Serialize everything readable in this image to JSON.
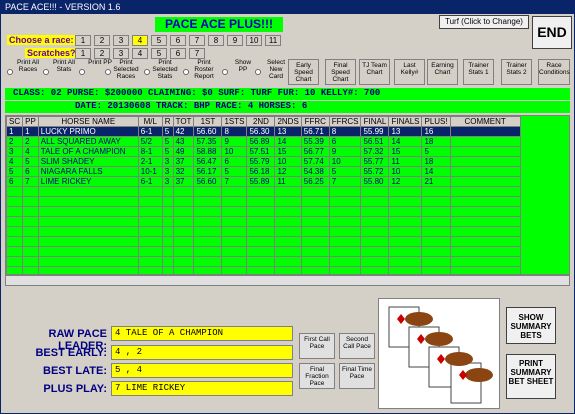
{
  "window": {
    "title": "PACE ACE!!! - VERSION 1.6"
  },
  "header": {
    "heading": "PACE ACE PLUS!!!",
    "choose_label": "Choose a race:",
    "scratches_label": "Scratches?",
    "race_buttons": [
      "1",
      "2",
      "3",
      "4",
      "5",
      "6",
      "7",
      "8",
      "9",
      "10",
      "11"
    ],
    "selected_race": "4",
    "scratch_buttons": [
      "1",
      "2",
      "3",
      "4",
      "5",
      "6",
      "7"
    ],
    "turf_button": "Turf (Click to Change)",
    "end_button": "END"
  },
  "options": [
    {
      "label": "Print All Races"
    },
    {
      "label": "Print All Stats"
    },
    {
      "label": "Print PP"
    },
    {
      "label": "Print Selected Races"
    },
    {
      "label": "Print Selected Stats"
    },
    {
      "label": "Print Roster Report"
    },
    {
      "label": "Show PP"
    },
    {
      "label": "Select New Card"
    }
  ],
  "chart_buttons": [
    {
      "label": "Early Speed Chart"
    },
    {
      "label": "Final Speed Chart"
    },
    {
      "label": "TJ Team Chart"
    },
    {
      "label": "Last Kelly#"
    },
    {
      "label": "Earning Chart"
    },
    {
      "label": "Trainer Stats 1"
    },
    {
      "label": "Trainer Stats 2"
    },
    {
      "label": "Race Conditions"
    }
  ],
  "info_line1": "CLASS: 02   PURSE: $200000   CLAIMING: $0    SURF: TURF    FUR: 10   KELLY#: 700",
  "info_line2": "DATE: 20130608    TRACK: BHP     RACE: 4    HORSES: 6",
  "table": {
    "columns": [
      "SC",
      "PP",
      "HORSE NAME",
      "M/L",
      "R",
      "TOT",
      "1ST",
      "1STS",
      "2ND",
      "2NDS",
      "FFRC",
      "FFRCS",
      "FINAL",
      "FINALS",
      "PLUS!",
      "COMMENT"
    ],
    "rows": [
      [
        "1",
        "1",
        "LUCKY PRIMO",
        "6-1",
        "5",
        "42",
        "56.60",
        "8",
        "56.30",
        "13",
        "56.71",
        "8",
        "55.99",
        "13",
        "16",
        ""
      ],
      [
        "2",
        "2",
        "ALL SQUARED AWAY",
        "5/2",
        "5",
        "43",
        "57.35",
        "9",
        "56.89",
        "14",
        "55.39",
        "6",
        "56.51",
        "14",
        "18",
        ""
      ],
      [
        "3",
        "4",
        "TALE OF A CHAMPION",
        "8-1",
        "5",
        "49",
        "58.88",
        "10",
        "57.51",
        "15",
        "56.77",
        "9",
        "57.32",
        "15",
        "5",
        ""
      ],
      [
        "4",
        "5",
        "SLIM SHADEY",
        "2-1",
        "3",
        "37",
        "56.47",
        "6",
        "55.79",
        "10",
        "57.74",
        "10",
        "55.77",
        "11",
        "18",
        ""
      ],
      [
        "5",
        "6",
        "NIAGARA FALLS",
        "10-1",
        "3",
        "32",
        "56.17",
        "5",
        "56.18",
        "12",
        "54.38",
        "5",
        "55.72",
        "10",
        "14",
        ""
      ],
      [
        "6",
        "7",
        "LIME RICKEY",
        "6-1",
        "3",
        "37",
        "56.60",
        "7",
        "55.89",
        "11",
        "56.25",
        "7",
        "55.80",
        "12",
        "21",
        ""
      ]
    ]
  },
  "bottom": {
    "raw_pace_label": "RAW PACE LEADER:",
    "raw_pace_value": "4    TALE OF A CHAMPION",
    "best_early_label": "BEST EARLY:",
    "best_early_value": "4  ,   2",
    "best_late_label": "BEST LATE:",
    "best_late_value": "5  ,   4",
    "plus_play_label": "PLUS PLAY:",
    "plus_play_value": "7    LIME RICKEY",
    "first_call": "First Call Pace",
    "second_call": "Second Call Pace",
    "final_fraction": "Final Fraction Pace",
    "final_time": "Final Time Pace",
    "show_summary": "SHOW SUMMARY BETS",
    "print_summary": "PRINT SUMMARY BET SHEET"
  }
}
